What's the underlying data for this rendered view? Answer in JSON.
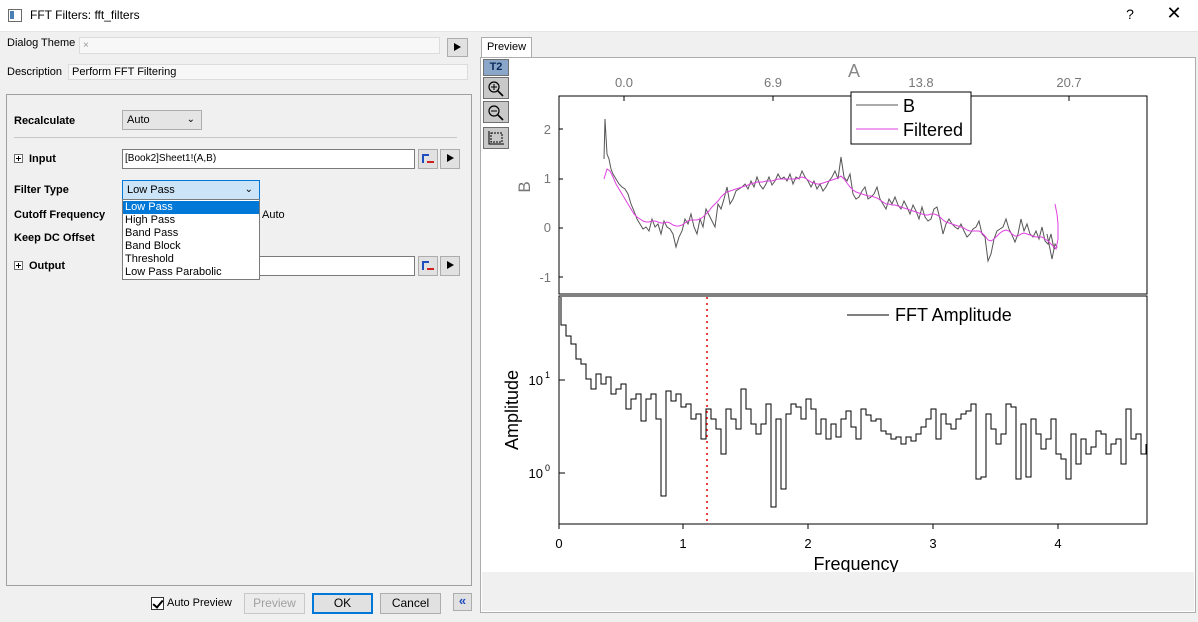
{
  "window": {
    "title": "FFT Filters: fft_filters",
    "help_label": "?",
    "close_label": "✕"
  },
  "dialog_theme": {
    "label": "Dialog Theme",
    "value": "×"
  },
  "description": {
    "label": "Description",
    "value": "Perform FFT Filtering"
  },
  "params": {
    "recalculate": {
      "label": "Recalculate",
      "value": "Auto"
    },
    "input": {
      "label": "Input",
      "value": "[Book2]Sheet1!(A,B)"
    },
    "filter_type": {
      "label": "Filter Type",
      "value": "Low Pass"
    },
    "cutoff": {
      "label": "Cutoff Frequency",
      "suffix": "Auto"
    },
    "keep_dc": {
      "label": "Keep DC Offset"
    },
    "output": {
      "label": "Output"
    }
  },
  "filter_options": [
    "Low Pass",
    "High Pass",
    "Band Pass",
    "Band Block",
    "Threshold",
    "Low Pass Parabolic"
  ],
  "footer": {
    "auto_preview_label": "Auto Preview",
    "auto_preview_checked": true,
    "preview_button": "Preview",
    "ok_button": "OK",
    "cancel_button": "Cancel",
    "collapse_label": "«"
  },
  "preview": {
    "tab_label": "Preview",
    "tool_label": "T2",
    "top_axis_title": "A",
    "top_ticks": [
      "0.0",
      "6.9",
      "13.8",
      "20.7"
    ],
    "top_plot": {
      "ylabel": "B",
      "yticks": [
        "2",
        "1",
        "0",
        "-1"
      ],
      "legend": [
        "B",
        "Filtered"
      ],
      "series_colors": [
        "#555555",
        "#e040e0"
      ]
    },
    "bottom_plot": {
      "ylabel": "Amplitude",
      "xlabel": "Frequency",
      "xticks": [
        "0",
        "1",
        "2",
        "3",
        "4"
      ],
      "yticks_base": [
        "10",
        "10"
      ],
      "yticks_exp": [
        "1",
        "0"
      ],
      "legend": "FFT Amplitude",
      "cutoff_color": "#e00000"
    }
  }
}
